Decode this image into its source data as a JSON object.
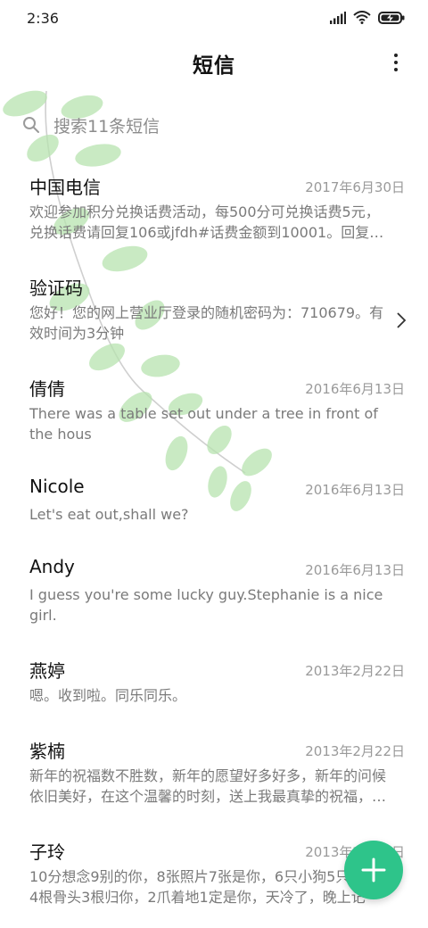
{
  "status_bar": {
    "time": "2:36",
    "icons": [
      "signal-icon",
      "wifi-icon",
      "battery-charging-icon"
    ]
  },
  "header": {
    "title": "短信",
    "more_icon": "more-vertical-icon"
  },
  "search": {
    "placeholder": "搜索11条短信",
    "icon": "search-icon"
  },
  "conversations": [
    {
      "name": "中国电信",
      "date": "2017年6月30日",
      "preview": "欢迎参加积分兑换话费活动，每500分可兑换话费5元，兑换话费请回复106或jfdh#话费金额到10001。回复…"
    },
    {
      "name": "验证码",
      "date": "",
      "preview": "您好！您的网上营业厅登录的随机密码为：710679。有效时间为3分钟"
    },
    {
      "name": "倩倩",
      "date": "2016年6月13日",
      "preview": "There was a table set out under a tree in front of the hous"
    },
    {
      "name": "Nicole",
      "date": "2016年6月13日",
      "preview": "Let's eat out,shall we?"
    },
    {
      "name": "Andy",
      "date": "2016年6月13日",
      "preview": "I guess you're some lucky guy.Stephanie is a nice girl."
    },
    {
      "name": "燕婷",
      "date": "2013年2月22日",
      "preview": "嗯。收到啦。同乐同乐。"
    },
    {
      "name": "紫楠",
      "date": "2013年2月22日",
      "preview": "新年的祝福数不胜数，新年的愿望好多好多，新年的问候依旧美好，在这个温馨的时刻，送上我最真挚的祝福，…"
    },
    {
      "name": "子玲",
      "date": "2013年2月22日",
      "preview": "10分想念9别的你，8张照片7张是你，6只小狗5只像你，4根骨头3根归你，2爪着地1定是你，天冷了，晚上记得…"
    }
  ],
  "fab": {
    "icon": "plus-icon"
  },
  "colors": {
    "accent": "#2ec48a",
    "leaf": "#a8dca0",
    "secondary_text": "#7a7a7a",
    "date_text": "#9a9a9a"
  }
}
